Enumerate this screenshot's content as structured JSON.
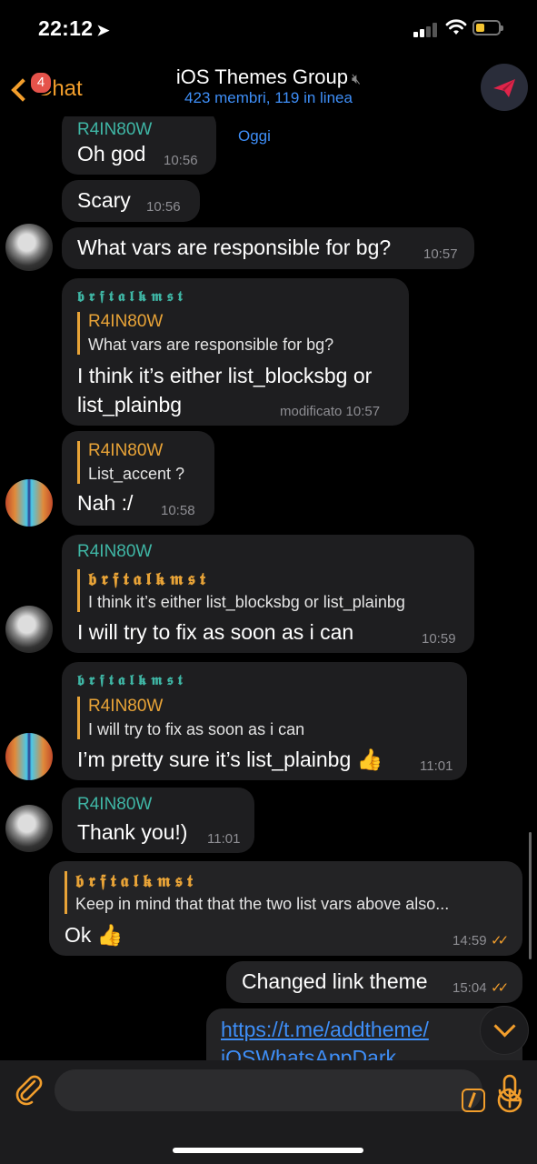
{
  "status_bar": {
    "time": "22:12"
  },
  "header": {
    "back_label": "Chat",
    "back_badge": "4",
    "title": "iOS Themes Group",
    "subtitle": "423 membri, 119 in linea"
  },
  "chat": {
    "date": "Oggi",
    "messages": [
      {
        "sender": "R4IN80W",
        "text": "Oh god",
        "time": "10:56"
      },
      {
        "text": "Scary",
        "time": "10:56"
      },
      {
        "text": "What vars are responsible for bg?",
        "time": "10:57"
      },
      {
        "sender": "𝖇𝖗𝖋𝖙𝖆𝖑𝖐𝖒𝖘𝖙",
        "reply_name": "R4IN80W",
        "reply_text": "What vars are responsible for bg?",
        "text_line1": "I think it’s either list_blocksbg or",
        "text_line2": "list_plainbg",
        "time": "modificato 10:57"
      },
      {
        "reply_name": "R4IN80W",
        "reply_text": "List_accent ?",
        "text": "Nah :/",
        "time": "10:58"
      },
      {
        "sender": "R4IN80W",
        "reply_name": "𝖇𝖗𝖋𝖙𝖆𝖑𝖐𝖒𝖘𝖙",
        "reply_text": "I think it’s either list_blocksbg or list_plainbg",
        "text": "I will try to fix as soon as i can",
        "time": "10:59"
      },
      {
        "sender": "𝖇𝖗𝖋𝖙𝖆𝖑𝖐𝖒𝖘𝖙",
        "reply_name": "R4IN80W",
        "reply_text": "I will try to fix as soon as i can",
        "text": "I’m pretty sure it’s list_plainbg 👍",
        "time": "11:01"
      },
      {
        "sender": "R4IN80W",
        "text": "Thank you!)",
        "time": "11:01"
      },
      {
        "reply_name": "𝖇𝖗𝖋𝖙𝖆𝖑𝖐𝖒𝖘𝖙",
        "reply_text": "Keep in mind that that the two list vars above also...",
        "text": "Ok 👍",
        "time": "14:59",
        "read": "✓✓"
      },
      {
        "text": "Changed link theme",
        "time": "15:04",
        "read": "✓✓"
      },
      {
        "link_line1": "https://t.me/addtheme/",
        "link_line2": "iOSWhatsAppDark"
      }
    ]
  },
  "colors": {
    "accent": "#f29e2c",
    "link": "#3e8ef7",
    "sender_teal": "#3fb6a5",
    "sender_gold": "#e8a337",
    "badge": "#e5534b"
  }
}
